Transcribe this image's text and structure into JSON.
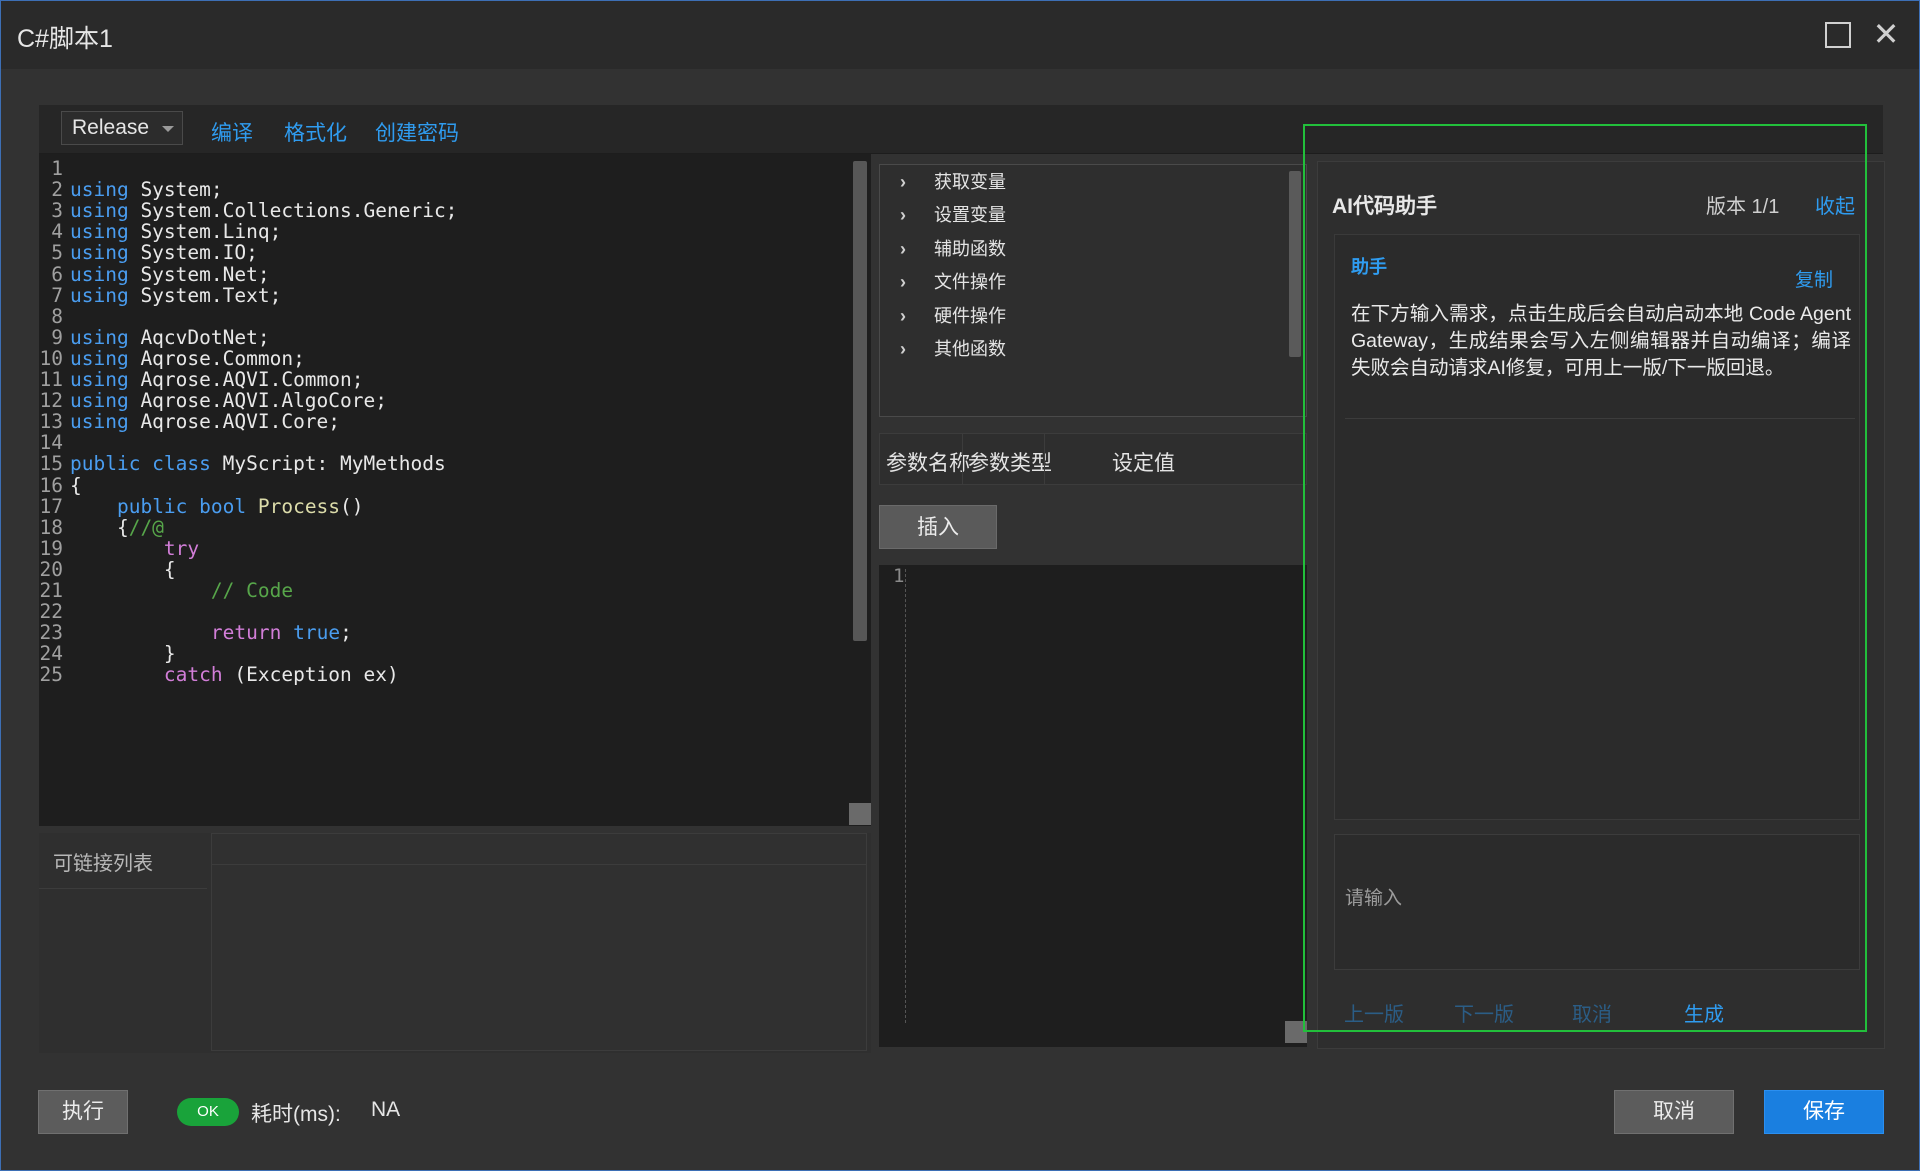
{
  "window": {
    "title": "C#脚本1"
  },
  "toolbar": {
    "config_value": "Release",
    "compile_label": "编译",
    "format_label": "格式化",
    "create_password_label": "创建密码"
  },
  "editor": {
    "lines": [
      {
        "n": "1",
        "parts": []
      },
      {
        "n": "2",
        "parts": [
          [
            "kw",
            "using"
          ],
          [
            "tx",
            " System;"
          ]
        ]
      },
      {
        "n": "3",
        "parts": [
          [
            "kw",
            "using"
          ],
          [
            "tx",
            " System.Collections.Generic;"
          ]
        ]
      },
      {
        "n": "4",
        "parts": [
          [
            "kw",
            "using"
          ],
          [
            "tx",
            " System.Linq;"
          ]
        ]
      },
      {
        "n": "5",
        "parts": [
          [
            "kw",
            "using"
          ],
          [
            "tx",
            " System.IO;"
          ]
        ]
      },
      {
        "n": "6",
        "parts": [
          [
            "kw",
            "using"
          ],
          [
            "tx",
            " System.Net;"
          ]
        ]
      },
      {
        "n": "7",
        "parts": [
          [
            "kw",
            "using"
          ],
          [
            "tx",
            " System.Text;"
          ]
        ]
      },
      {
        "n": "8",
        "parts": []
      },
      {
        "n": "9",
        "parts": [
          [
            "kw",
            "using"
          ],
          [
            "tx",
            " AqcvDotNet;"
          ]
        ]
      },
      {
        "n": "10",
        "parts": [
          [
            "kw",
            "using"
          ],
          [
            "tx",
            " Aqrose.Common;"
          ]
        ]
      },
      {
        "n": "11",
        "parts": [
          [
            "kw",
            "using"
          ],
          [
            "tx",
            " Aqrose.AQVI.Common;"
          ]
        ]
      },
      {
        "n": "12",
        "parts": [
          [
            "kw",
            "using"
          ],
          [
            "tx",
            " Aqrose.AQVI.AlgoCore;"
          ]
        ]
      },
      {
        "n": "13",
        "parts": [
          [
            "kw",
            "using"
          ],
          [
            "tx",
            " Aqrose.AQVI.Core;"
          ]
        ]
      },
      {
        "n": "14",
        "parts": []
      },
      {
        "n": "15",
        "parts": [
          [
            "kw",
            "public class"
          ],
          [
            "tx",
            " MyScript: MyMethods"
          ]
        ]
      },
      {
        "n": "16",
        "parts": [
          [
            "tx",
            "{"
          ]
        ]
      },
      {
        "n": "17",
        "parts": [
          [
            "tx",
            "    "
          ],
          [
            "kw",
            "public bool"
          ],
          [
            "tx",
            " "
          ],
          [
            "fn",
            "Process"
          ],
          [
            "tx",
            "()"
          ]
        ]
      },
      {
        "n": "18",
        "parts": [
          [
            "tx",
            "    {"
          ],
          [
            "cm",
            "//@"
          ]
        ]
      },
      {
        "n": "19",
        "parts": [
          [
            "tx",
            "        "
          ],
          [
            "ctl",
            "try"
          ]
        ]
      },
      {
        "n": "20",
        "parts": [
          [
            "tx",
            "        {"
          ]
        ]
      },
      {
        "n": "21",
        "parts": [
          [
            "tx",
            "            "
          ],
          [
            "cm",
            "// Code"
          ]
        ]
      },
      {
        "n": "22",
        "parts": []
      },
      {
        "n": "23",
        "parts": [
          [
            "tx",
            "            "
          ],
          [
            "ctl",
            "return"
          ],
          [
            "tx",
            " "
          ],
          [
            "kw",
            "true"
          ],
          [
            "tx",
            ";"
          ]
        ]
      },
      {
        "n": "24",
        "parts": [
          [
            "tx",
            "        }"
          ]
        ]
      },
      {
        "n": "25",
        "parts": [
          [
            "tx",
            "        "
          ],
          [
            "ctl",
            "catch"
          ],
          [
            "tx",
            " (Exception ex)"
          ]
        ]
      }
    ]
  },
  "link_panel": {
    "label": "可链接列表"
  },
  "functions": {
    "items": [
      {
        "label": "获取变量"
      },
      {
        "label": "设置变量"
      },
      {
        "label": "辅助函数"
      },
      {
        "label": "文件操作"
      },
      {
        "label": "硬件操作"
      },
      {
        "label": "其他函数"
      }
    ]
  },
  "params": {
    "col_name": "参数名称",
    "col_type": "参数类型",
    "col_value": "设定值",
    "insert_label": "插入"
  },
  "snippet": {
    "line_number": "1"
  },
  "ai": {
    "title": "AI代码助手",
    "version": "版本 1/1",
    "collapse_label": "收起",
    "role": "助手",
    "copy_label": "复制",
    "message": "在下方输入需求，点击生成后会自动启动本地 Code Agent Gateway，生成结果会写入左侧编辑器并自动编译；编译失败会自动请求AI修复，可用上一版/下一版回退。",
    "input_placeholder": "请输入",
    "prev_label": "上一版",
    "next_label": "下一版",
    "cancel_label": "取消",
    "generate_label": "生成"
  },
  "footer": {
    "run_label": "执行",
    "status": "OK",
    "time_label": "耗时(ms):",
    "time_value": "NA",
    "cancel_label": "取消",
    "save_label": "保存"
  },
  "colors": {
    "accent": "#2f9cf0",
    "ok": "#19a33a",
    "highlight_frame": "#22bf3b",
    "save_button": "#1a7fe0"
  }
}
